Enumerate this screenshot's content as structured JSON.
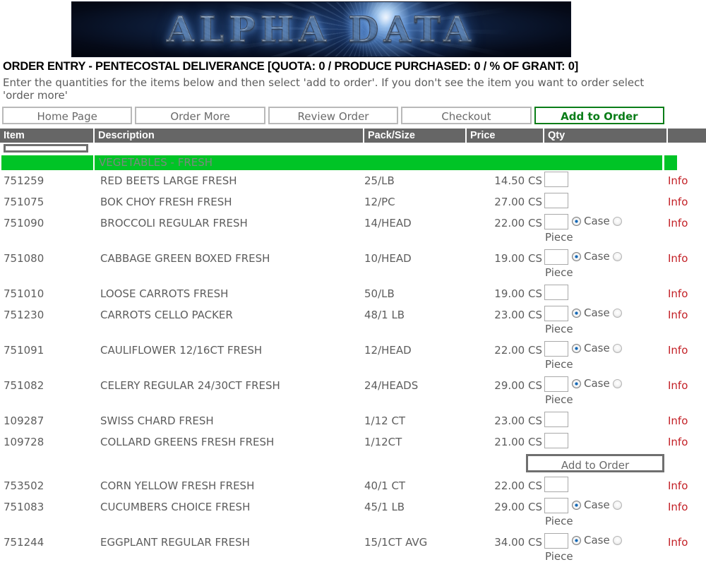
{
  "banner": {
    "logo_text": "ALPHA DATA"
  },
  "header": {
    "title": "ORDER ENTRY - PENTECOSTAL DELIVERANCE [QUOTA: 0 / PRODUCE PURCHASED: 0 / % OF GRANT: 0]",
    "subtitle": "Enter the quantities for the items below and then select 'add to order'. If you don't see the item you want to order select 'order more'"
  },
  "nav": [
    {
      "label": "Home Page",
      "primary": false
    },
    {
      "label": "Order More",
      "primary": false
    },
    {
      "label": "Review Order",
      "primary": false
    },
    {
      "label": "Checkout",
      "primary": false
    },
    {
      "label": "Add to Order",
      "primary": true
    }
  ],
  "table": {
    "columns": [
      "Item",
      "Description",
      "Pack/Size",
      "Price",
      "Qty",
      ""
    ],
    "section_label": "VEGETABLES - FRESH",
    "info_label": "Info",
    "uom": {
      "case_label": "Case",
      "piece_label": "Piece"
    },
    "mid_add_button": "Add to Order",
    "rows": [
      {
        "item": "751259",
        "desc": "RED BEETS LARGE FRESH",
        "pack": "25/LB",
        "price": "14.50 CS",
        "uom": false,
        "qty": ""
      },
      {
        "item": "751075",
        "desc": "BOK CHOY FRESH FRESH",
        "pack": "12/PC",
        "price": "27.00 CS",
        "uom": false,
        "qty": ""
      },
      {
        "item": "751090",
        "desc": "BROCCOLI REGULAR FRESH",
        "pack": "14/HEAD",
        "price": "22.00 CS",
        "uom": true,
        "qty": ""
      },
      {
        "item": "751080",
        "desc": "CABBAGE GREEN BOXED FRESH",
        "pack": "10/HEAD",
        "price": "19.00 CS",
        "uom": true,
        "qty": ""
      },
      {
        "item": "751010",
        "desc": "LOOSE CARROTS FRESH",
        "pack": "50/LB",
        "price": "19.00 CS",
        "uom": false,
        "qty": ""
      },
      {
        "item": "751230",
        "desc": "CARROTS CELLO PACKER",
        "pack": "48/1 LB",
        "price": "23.00 CS",
        "uom": true,
        "qty": ""
      },
      {
        "item": "751091",
        "desc": "CAULIFLOWER 12/16CT FRESH",
        "pack": "12/HEAD",
        "price": "22.00 CS",
        "uom": true,
        "qty": ""
      },
      {
        "item": "751082",
        "desc": "CELERY REGULAR 24/30CT FRESH",
        "pack": "24/HEADS",
        "price": "29.00 CS",
        "uom": true,
        "qty": ""
      },
      {
        "item": "109287",
        "desc": "SWISS CHARD FRESH",
        "pack": "1/12 CT",
        "price": "23.00 CS",
        "uom": false,
        "qty": ""
      },
      {
        "item": "109728",
        "desc": "COLLARD GREENS FRESH FRESH",
        "pack": "1/12CT",
        "price": "21.00 CS",
        "uom": false,
        "qty": ""
      },
      {
        "item": "753502",
        "desc": "CORN YELLOW FRESH FRESH",
        "pack": "40/1 CT",
        "price": "22.00 CS",
        "uom": false,
        "qty": ""
      },
      {
        "item": "751083",
        "desc": "CUCUMBERS CHOICE FRESH",
        "pack": "45/1 LB",
        "price": "29.00 CS",
        "uom": true,
        "qty": ""
      },
      {
        "item": "751244",
        "desc": "EGGPLANT REGULAR FRESH",
        "pack": "15/1CT AVG",
        "price": "34.00 CS",
        "uom": true,
        "qty": ""
      }
    ],
    "mid_button_after_row_index": 9
  },
  "colors": {
    "header_bg": "#666666",
    "section_green": "#00c426",
    "accent_green": "#0a7d18",
    "info_red": "#c32026",
    "radio_blue": "#1769b5"
  }
}
